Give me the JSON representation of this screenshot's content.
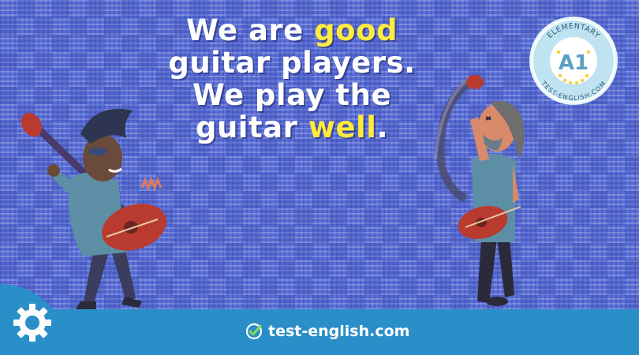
{
  "headline": {
    "line1_pre": "We are ",
    "line1_hl": "good",
    "line2": "guitar players.",
    "line3": "We play the",
    "line4_pre": "guitar ",
    "line4_hl": "well",
    "line4_post": "."
  },
  "badge": {
    "top_text": "ELEMENTARY",
    "level": "A1",
    "bottom_text": "TEST-ENGLISH.COM"
  },
  "footer": {
    "site": "test-english.com"
  },
  "colors": {
    "background": "#5a6fd6",
    "highlight": "#ffeb3b",
    "footer": "#2a8ec9",
    "badge": "#bfe3f0"
  },
  "icons": {
    "settings": "gear-icon",
    "check": "check-circle-icon"
  }
}
